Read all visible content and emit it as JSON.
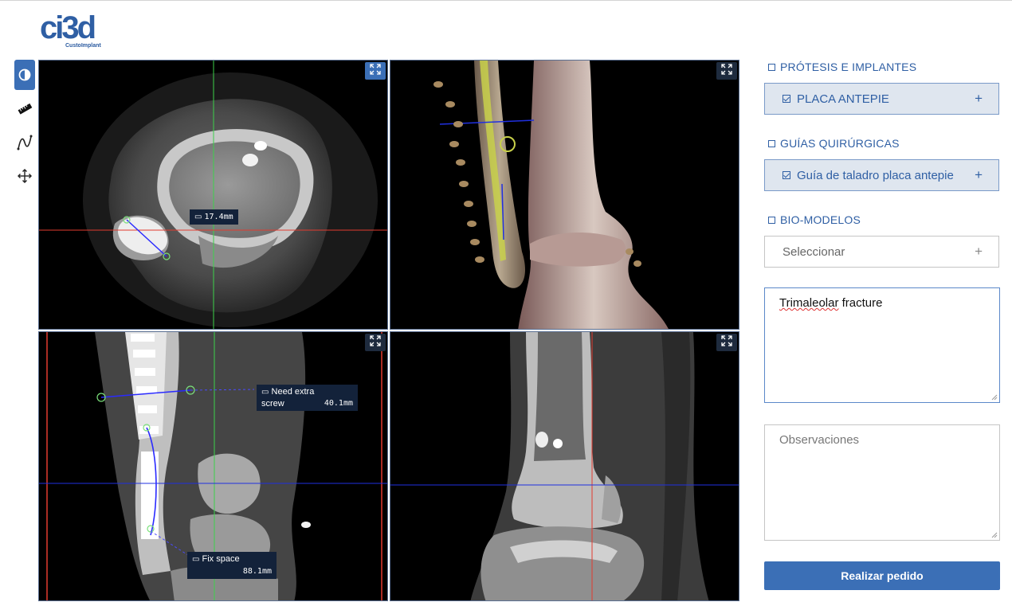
{
  "brand": {
    "logo_text": "ci3d",
    "tagline": "CustoImplant",
    "color": "#2f5fa4"
  },
  "toolbar": {
    "tools": [
      {
        "name": "contrast-icon",
        "active": true
      },
      {
        "name": "ruler-icon",
        "active": false
      },
      {
        "name": "curve-icon",
        "active": false
      },
      {
        "name": "move-icon",
        "active": false
      }
    ]
  },
  "viewports": {
    "axial": {
      "annotation_label": "17.4mm"
    },
    "render3d": {},
    "sagittal": {
      "annotations": [
        {
          "line1": "Need extra",
          "line2": "screw",
          "value": "40.1mm"
        },
        {
          "line1": "Fix space",
          "value": "88.1mm"
        }
      ]
    },
    "coronal": {}
  },
  "sections": {
    "protesis": {
      "title": "PRÓTESIS E IMPLANTES",
      "item": "PLACA ANTEPIE"
    },
    "guias": {
      "title": "GUÍAS QUIRÚRGICAS",
      "item": "Guía de taladro placa antepie"
    },
    "biomodelos": {
      "title": "BIO-MODELOS",
      "placeholder": "Seleccionar"
    }
  },
  "notes": {
    "diagnosis_word1": "Trimaleolar",
    "diagnosis_word2": " fracture",
    "observations_placeholder": "Observaciones"
  },
  "submit_label": "Realizar pedido",
  "colors": {
    "accent": "#3b6fb6",
    "crosshair_green": "#3cd14a",
    "crosshair_red": "#e23b2f",
    "crosshair_blue": "#2030e0"
  }
}
